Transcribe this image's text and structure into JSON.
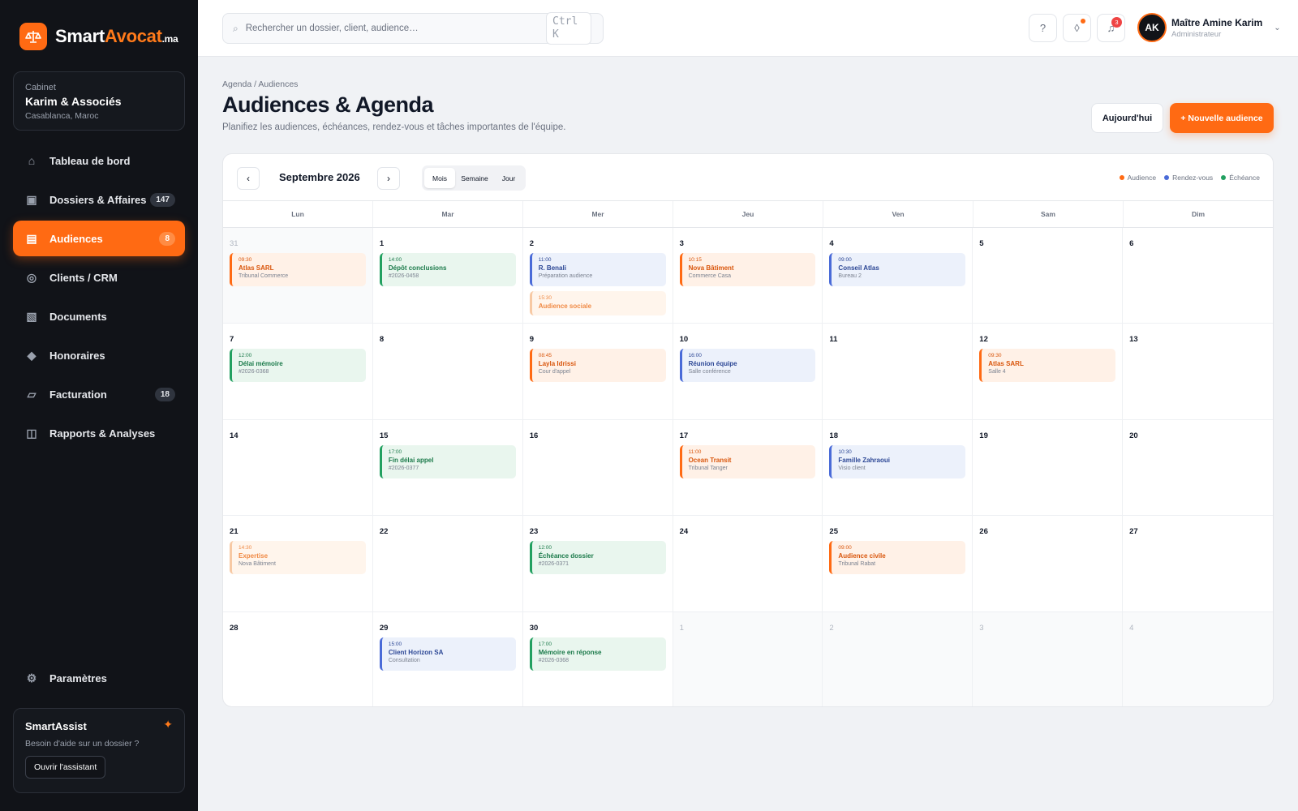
{
  "brand": {
    "name_main": "Smart",
    "name_accent": "Avocat",
    "tld": ".ma"
  },
  "cabinet": {
    "label": "Cabinet",
    "name": "Karim & Associés",
    "location": "Casablanca, Maroc"
  },
  "nav": [
    {
      "id": "dashboard",
      "label": "Tableau de bord",
      "icon": "home-icon",
      "glyph": "⌂",
      "badge": ""
    },
    {
      "id": "dossiers",
      "label": "Dossiers & Affaires",
      "icon": "folder-icon",
      "glyph": "▣",
      "badge": "147"
    },
    {
      "id": "audiences",
      "label": "Audiences",
      "icon": "calendar-icon",
      "glyph": "▤",
      "badge": "8",
      "active": true
    },
    {
      "id": "clients",
      "label": "Clients / CRM",
      "icon": "clients-icon",
      "glyph": "◎",
      "badge": ""
    },
    {
      "id": "documents",
      "label": "Documents",
      "icon": "document-icon",
      "glyph": "▧",
      "badge": ""
    },
    {
      "id": "honoraires",
      "label": "Honoraires",
      "icon": "fees-icon",
      "glyph": "◆",
      "badge": ""
    },
    {
      "id": "facturation",
      "label": "Facturation",
      "icon": "invoice-icon",
      "glyph": "▱",
      "badge": "18"
    },
    {
      "id": "rapports",
      "label": "Rapports & Analyses",
      "icon": "reports-icon",
      "glyph": "◫",
      "badge": ""
    }
  ],
  "settings": {
    "label": "Paramètres",
    "icon": "gear-icon",
    "glyph": "⚙"
  },
  "assistant": {
    "title": "SmartAssist",
    "text": "Besoin d'aide sur un dossier ?",
    "button": "Ouvrir l'assistant"
  },
  "search": {
    "placeholder": "Rechercher un dossier, client, audience…",
    "shortcut": "Ctrl K"
  },
  "notifications": {
    "count": "3"
  },
  "user": {
    "initials": "AK",
    "name": "Maître Amine Karim",
    "role": "Administrateur"
  },
  "page": {
    "breadcrumb": "Agenda / Audiences",
    "title": "Audiences & Agenda",
    "subtitle": "Planifiez les audiences, échéances, rendez-vous et tâches importantes de l'équipe.",
    "today_button": "Aujourd'hui",
    "new_button": "+ Nouvelle audience"
  },
  "calendar": {
    "month": "Septembre 2026",
    "views": [
      "Mois",
      "Semaine",
      "Jour"
    ],
    "active_view": "Mois",
    "legend": [
      {
        "label": "Audience",
        "color": "#ff6a13"
      },
      {
        "label": "Rendez-vous",
        "color": "#4a6bd8"
      },
      {
        "label": "Échéance",
        "color": "#22a060"
      }
    ],
    "weekdays": [
      "Lun",
      "Mar",
      "Mer",
      "Jeu",
      "Ven",
      "Sam",
      "Dim"
    ],
    "days": [
      {
        "n": "31",
        "muted": true,
        "events": [
          {
            "type": "orange",
            "time": "09:30",
            "title": "Atlas SARL",
            "sub": "Tribunal Commerce"
          }
        ]
      },
      {
        "n": "1",
        "events": [
          {
            "type": "green",
            "time": "14:00",
            "title": "Dépôt conclusions",
            "sub": "#2026-0458"
          }
        ]
      },
      {
        "n": "2",
        "events": [
          {
            "type": "blue",
            "time": "11:00",
            "title": "R. Benali",
            "sub": "Préparation audience"
          },
          {
            "type": "pale",
            "time": "15:30",
            "title": "Audience sociale",
            "sub": ""
          }
        ]
      },
      {
        "n": "3",
        "events": [
          {
            "type": "orange",
            "time": "10:15",
            "title": "Nova Bâtiment",
            "sub": "Commerce Casa"
          }
        ]
      },
      {
        "n": "4",
        "events": [
          {
            "type": "blue",
            "time": "09:00",
            "title": "Conseil Atlas",
            "sub": "Bureau 2"
          }
        ]
      },
      {
        "n": "5",
        "events": []
      },
      {
        "n": "6",
        "events": []
      },
      {
        "n": "7",
        "events": [
          {
            "type": "green",
            "time": "12:00",
            "title": "Délai mémoire",
            "sub": "#2026-0368"
          }
        ]
      },
      {
        "n": "8",
        "events": []
      },
      {
        "n": "9",
        "events": [
          {
            "type": "orange",
            "time": "08:45",
            "title": "Layla Idrissi",
            "sub": "Cour d'appel"
          }
        ]
      },
      {
        "n": "10",
        "events": [
          {
            "type": "blue",
            "time": "16:00",
            "title": "Réunion équipe",
            "sub": "Salle conférence"
          }
        ]
      },
      {
        "n": "11",
        "events": []
      },
      {
        "n": "12",
        "events": [
          {
            "type": "orange",
            "time": "09:30",
            "title": "Atlas SARL",
            "sub": "Salle 4"
          }
        ]
      },
      {
        "n": "13",
        "events": []
      },
      {
        "n": "14",
        "events": []
      },
      {
        "n": "15",
        "events": [
          {
            "type": "green",
            "time": "17:00",
            "title": "Fin délai appel",
            "sub": "#2026-0377"
          }
        ]
      },
      {
        "n": "16",
        "events": []
      },
      {
        "n": "17",
        "events": [
          {
            "type": "orange",
            "time": "11:00",
            "title": "Ocean Transit",
            "sub": "Tribunal Tanger"
          }
        ]
      },
      {
        "n": "18",
        "events": [
          {
            "type": "blue",
            "time": "10:30",
            "title": "Famille Zahraoui",
            "sub": "Visio client"
          }
        ]
      },
      {
        "n": "19",
        "events": []
      },
      {
        "n": "20",
        "events": []
      },
      {
        "n": "21",
        "events": [
          {
            "type": "pale",
            "time": "14:30",
            "title": "Expertise",
            "sub": "Nova Bâtiment"
          }
        ]
      },
      {
        "n": "22",
        "events": []
      },
      {
        "n": "23",
        "events": [
          {
            "type": "green",
            "time": "12:00",
            "title": "Échéance dossier",
            "sub": "#2026-0371"
          }
        ]
      },
      {
        "n": "24",
        "events": []
      },
      {
        "n": "25",
        "events": [
          {
            "type": "orange",
            "time": "09:00",
            "title": "Audience civile",
            "sub": "Tribunal Rabat"
          }
        ]
      },
      {
        "n": "26",
        "events": []
      },
      {
        "n": "27",
        "events": []
      },
      {
        "n": "28",
        "events": []
      },
      {
        "n": "29",
        "events": [
          {
            "type": "blue",
            "time": "15:00",
            "title": "Client Horizon SA",
            "sub": "Consultation"
          }
        ]
      },
      {
        "n": "30",
        "events": [
          {
            "type": "green",
            "time": "17:00",
            "title": "Mémoire en réponse",
            "sub": "#2026-0368"
          }
        ]
      },
      {
        "n": "1",
        "muted": true,
        "events": []
      },
      {
        "n": "2",
        "muted": true,
        "events": []
      },
      {
        "n": "3",
        "muted": true,
        "events": []
      },
      {
        "n": "4",
        "muted": true,
        "events": []
      }
    ]
  }
}
